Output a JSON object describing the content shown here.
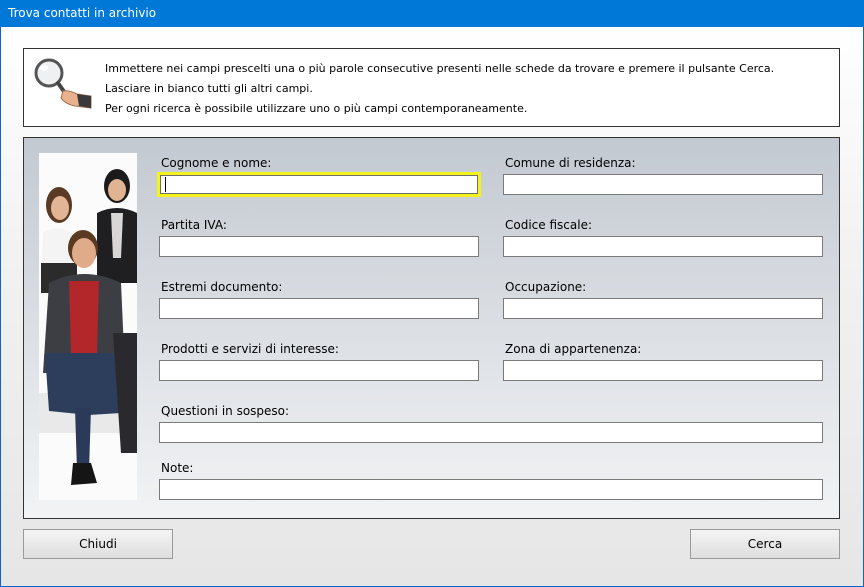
{
  "window": {
    "title": "Trova contatti in archivio"
  },
  "info": {
    "lines": [
      "Immettere nei campi prescelti una o più parole consecutive presenti nelle schede da trovare e premere il pulsante Cerca.",
      "Lasciare in bianco tutti gli altri campi.",
      "Per ogni ricerca è possibile utilizzare uno o più campi contemporaneamente."
    ]
  },
  "fields": {
    "cognome_nome": {
      "label": "Cognome e nome:",
      "value": ""
    },
    "comune_residenza": {
      "label": "Comune di residenza:",
      "value": ""
    },
    "partita_iva": {
      "label": "Partita IVA:",
      "value": ""
    },
    "codice_fiscale": {
      "label": "Codice fiscale:",
      "value": ""
    },
    "estremi_documento": {
      "label": "Estremi documento:",
      "value": ""
    },
    "occupazione": {
      "label": "Occupazione:",
      "value": ""
    },
    "prodotti_servizi": {
      "label": "Prodotti e servizi di interesse:",
      "value": ""
    },
    "zona_appartenenza": {
      "label": "Zona di appartenenza:",
      "value": ""
    },
    "questioni_sospeso": {
      "label": "Questioni in sospeso:",
      "value": ""
    },
    "note": {
      "label": "Note:",
      "value": ""
    }
  },
  "buttons": {
    "close": "Chiudi",
    "search": "Cerca"
  },
  "colors": {
    "titlebar": "#0078d7",
    "focus": "#f3f21c"
  },
  "icons": {
    "header": "magnifier-icon"
  }
}
